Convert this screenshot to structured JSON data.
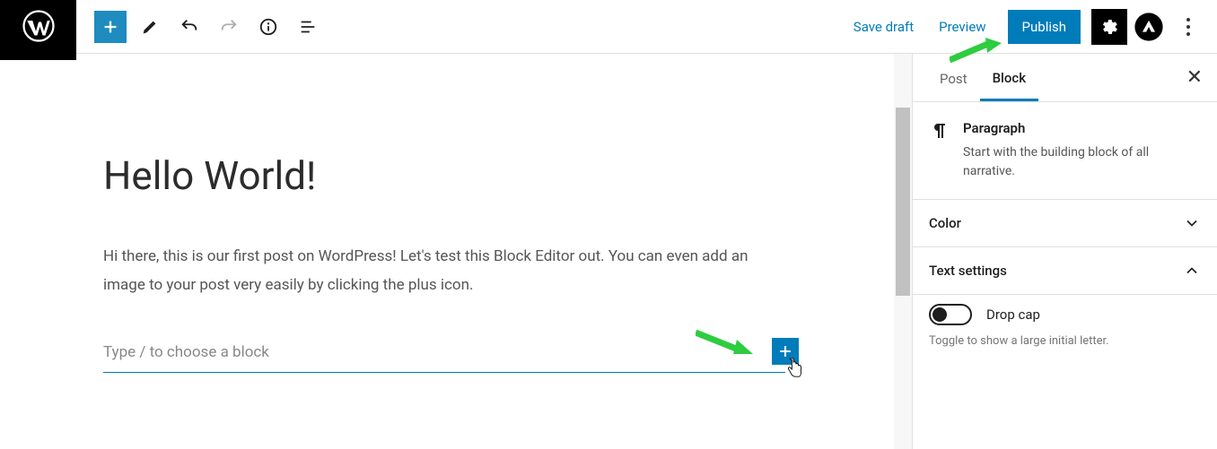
{
  "toolbar": {
    "save_draft": "Save draft",
    "preview": "Preview",
    "publish": "Publish"
  },
  "editor": {
    "title": "Hello World!",
    "body": "Hi there, this is our first post on WordPress! Let's test this Block Editor out. You can even add an image to your post very easily by clicking the plus icon.",
    "placeholder": "Type / to choose a block"
  },
  "sidebar": {
    "tabs": {
      "post": "Post",
      "block": "Block"
    },
    "block_name": "Paragraph",
    "block_desc": "Start with the building block of all narrative.",
    "sections": {
      "color": "Color",
      "text_settings": "Text settings"
    },
    "drop_cap": {
      "label": "Drop cap",
      "help": "Toggle to show a large initial letter."
    }
  }
}
